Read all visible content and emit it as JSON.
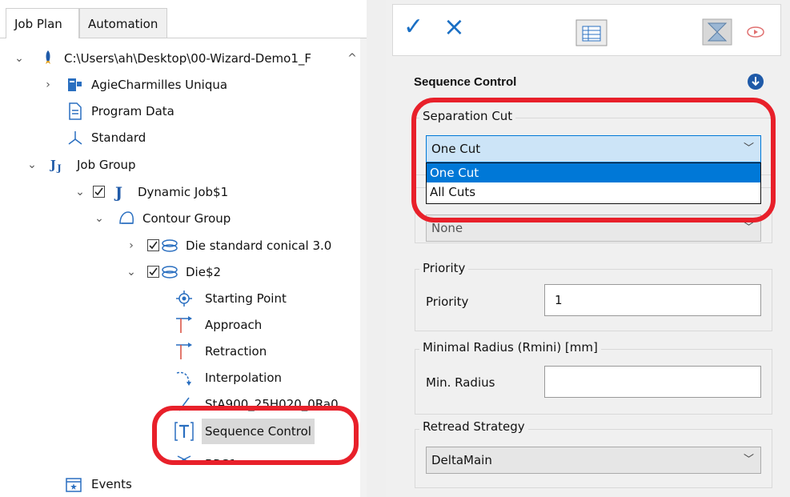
{
  "tabs": [
    {
      "label": "Job Plan",
      "active": true
    },
    {
      "label": "Automation",
      "active": false
    }
  ],
  "tree": [
    {
      "label": "C:\\Users\\ah\\Desktop\\00-Wizard-Demo1_F",
      "icon": "rocket-icon"
    },
    {
      "label": "AgieCharmilles Uniqua",
      "icon": "machine-icon"
    },
    {
      "label": "Program Data",
      "icon": "document-icon"
    },
    {
      "label": "Standard",
      "icon": "axes-icon"
    },
    {
      "label": "Job Group",
      "icon": "job-group-icon"
    },
    {
      "label": "Dynamic Job$1",
      "icon": "job-icon"
    },
    {
      "label": "Contour Group",
      "icon": "contour-group-icon"
    },
    {
      "label": "Die standard conical 3.0",
      "icon": "contour-icon"
    },
    {
      "label": "Die$2",
      "icon": "contour-icon"
    },
    {
      "label": "Starting Point",
      "icon": "target-icon"
    },
    {
      "label": "Approach",
      "icon": "approach-icon"
    },
    {
      "label": "Retraction",
      "icon": "retraction-icon"
    },
    {
      "label": "Interpolation",
      "icon": "interpolation-icon"
    },
    {
      "label": "StA900_25H020_0Ra0.",
      "icon": "technology-icon"
    },
    {
      "label": "Sequence Control",
      "icon": "text-tool-icon"
    },
    {
      "label": "BRS1",
      "icon": "brs-icon"
    },
    {
      "label": "Events",
      "icon": "calendar-icon"
    }
  ],
  "toolbar": {
    "ok_symbol": "✓",
    "cancel_symbol": "×"
  },
  "panel": {
    "title": "Sequence Control",
    "separation_cut": {
      "group_title": "Separation Cut",
      "selected": "One Cut",
      "options": [
        "One Cut",
        "All Cuts"
      ]
    },
    "hidden_select": {
      "value": "None"
    },
    "priority": {
      "group_title": "Priority",
      "label": "Priority",
      "value": "1"
    },
    "min_radius": {
      "group_title": "Minimal Radius (Rmini) [mm]",
      "label": "Min. Radius",
      "value": ""
    },
    "retread": {
      "group_title": "Retread Strategy",
      "selected": "DeltaMain"
    }
  },
  "colors": {
    "accent": "#0078d7",
    "highlight": "#e8202a",
    "check": "#1a6fc4"
  }
}
